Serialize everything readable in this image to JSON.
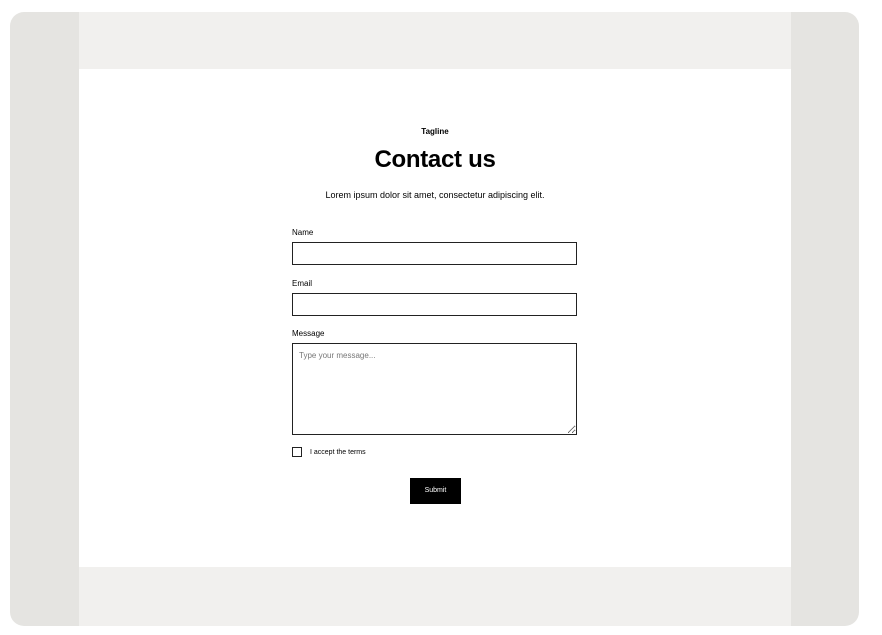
{
  "header": {
    "tagline": "Tagline",
    "title": "Contact us",
    "subtitle": "Lorem ipsum dolor sit amet, consectetur adipiscing elit."
  },
  "form": {
    "name": {
      "label": "Name",
      "value": ""
    },
    "email": {
      "label": "Email",
      "value": ""
    },
    "message": {
      "label": "Message",
      "placeholder": "Type your message...",
      "value": ""
    },
    "terms": {
      "label": "I accept the terms",
      "checked": false
    },
    "submit_label": "Submit"
  }
}
